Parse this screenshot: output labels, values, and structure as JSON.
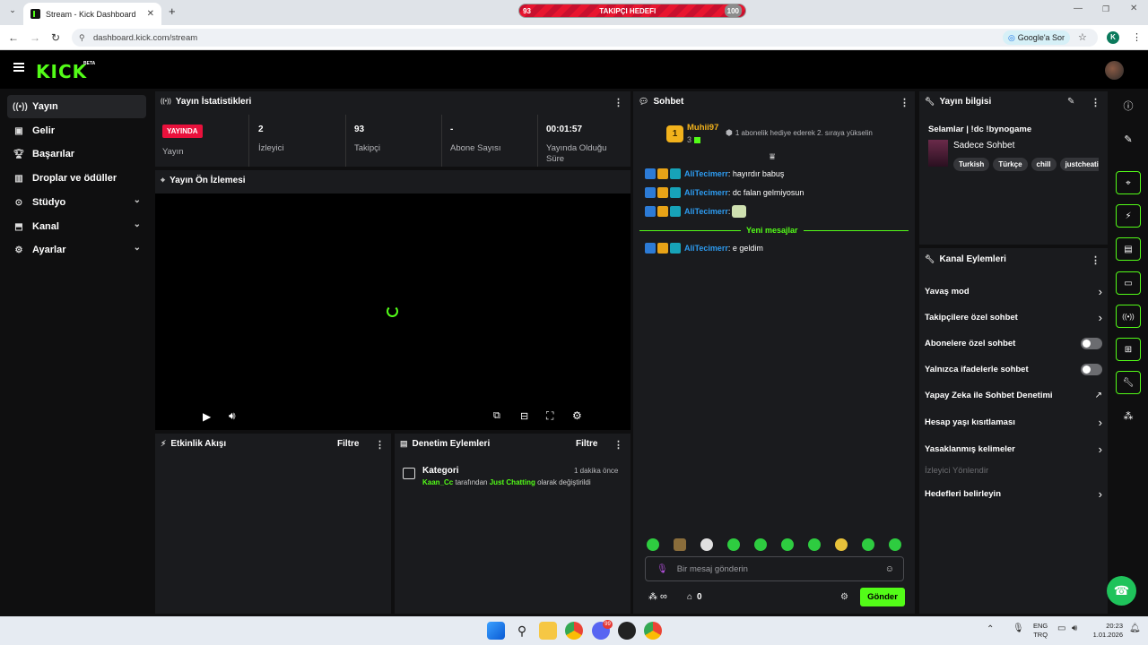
{
  "browser": {
    "tab_title": "Stream - Kick Dashboard",
    "url": "dashboard.kick.com/stream",
    "google_btn": "Google'a Sor",
    "profile_letter": "K",
    "goal_start": "93",
    "goal_label": "TAKIPÇI HEDEFI",
    "goal_end": "100"
  },
  "header": {
    "logo": "KICK",
    "beta": "BETA"
  },
  "sidebar": {
    "items": [
      {
        "label": "Yayın",
        "icon": "broadcast-icon"
      },
      {
        "label": "Gelir",
        "icon": "wallet-icon"
      },
      {
        "label": "Başarılar",
        "icon": "trophy-icon"
      },
      {
        "label": "Droplar ve ödüller",
        "icon": "gift-icon"
      },
      {
        "label": "Stüdyo",
        "icon": "studio-icon"
      },
      {
        "label": "Kanal",
        "icon": "channel-icon"
      },
      {
        "label": "Ayarlar",
        "icon": "gear-icon"
      }
    ]
  },
  "stats": {
    "title": "Yayın İstatistikleri",
    "live_badge": "YAYINDA",
    "stream_label": "Yayın",
    "viewers": "2",
    "viewers_label": "İzleyici",
    "followers": "93",
    "followers_label": "Takipçi",
    "subs": "-",
    "subs_label": "Abone Sayısı",
    "uptime": "00:01:57",
    "uptime_label": "Yayında Olduğu Süre"
  },
  "preview": {
    "title": "Yayın Ön İzlemesi"
  },
  "activity": {
    "title": "Etkinlik Akışı",
    "filter": "Filtre"
  },
  "moderation": {
    "title": "Denetim Eylemleri",
    "filter": "Filtre",
    "event_title": "Kategori",
    "event_time": "1 dakika önce",
    "event_user": "Kaan_Cc",
    "event_mid": " tarafından ",
    "event_category": "Just Chatting",
    "event_end": " olarak değiştirildi"
  },
  "chat": {
    "title": "Sohbet",
    "top_user": "Muhii97",
    "top_rank": "1",
    "top_count": "3",
    "gift_text": "1 abonelik hediye ederek 2. sıraya yükselin",
    "messages": [
      {
        "user": "AliTecimerr",
        "text": ": hayırdır babuş"
      },
      {
        "user": "AliTecimerr",
        "text": ": dc falan gelmiyosun"
      },
      {
        "user": "AliTecimerr",
        "text": ": "
      },
      {
        "user": "AliTecimerr",
        "text": ": e geldim"
      }
    ],
    "new_messages": "Yeni mesajlar",
    "input_placeholder": "Bir mesaj gönderin",
    "infinity": "∞",
    "store_count": "0",
    "send": "Gönder"
  },
  "info": {
    "title": "Yayın bilgisi",
    "stream_title": "Selamlar | !dc !bynogame",
    "category": "Sadece Sohbet",
    "tags": [
      "Turkish",
      "Türkçe",
      "chill",
      "justcheati"
    ]
  },
  "channel_actions": {
    "title": "Kanal Eylemleri",
    "rows": [
      {
        "label": "Yavaş mod",
        "kind": "arrow"
      },
      {
        "label": "Takipçilere özel sohbet",
        "kind": "arrow"
      },
      {
        "label": "Abonelere özel sohbet",
        "kind": "toggle"
      },
      {
        "label": "Yalnızca ifadelerle sohbet",
        "kind": "toggle"
      },
      {
        "label": "Yapay Zeka ile Sohbet Denetimi",
        "kind": "external"
      },
      {
        "label": "Hesap yaşı kısıtlaması",
        "kind": "arrow"
      },
      {
        "label": "Yasaklanmış kelimeler",
        "kind": "arrow"
      },
      {
        "label": "İzleyici Yönlendir",
        "kind": "disabled"
      },
      {
        "label": "Hedefleri belirleyin",
        "kind": "arrow"
      }
    ]
  },
  "taskbar": {
    "lang1": "ENG",
    "lang2": "TRQ",
    "time": "20:23",
    "date": "1.01.2026",
    "discord_badge": "99"
  },
  "colors": {
    "accent": "#53fc18",
    "live": "#e9113c",
    "panel": "#1a1b1e"
  }
}
